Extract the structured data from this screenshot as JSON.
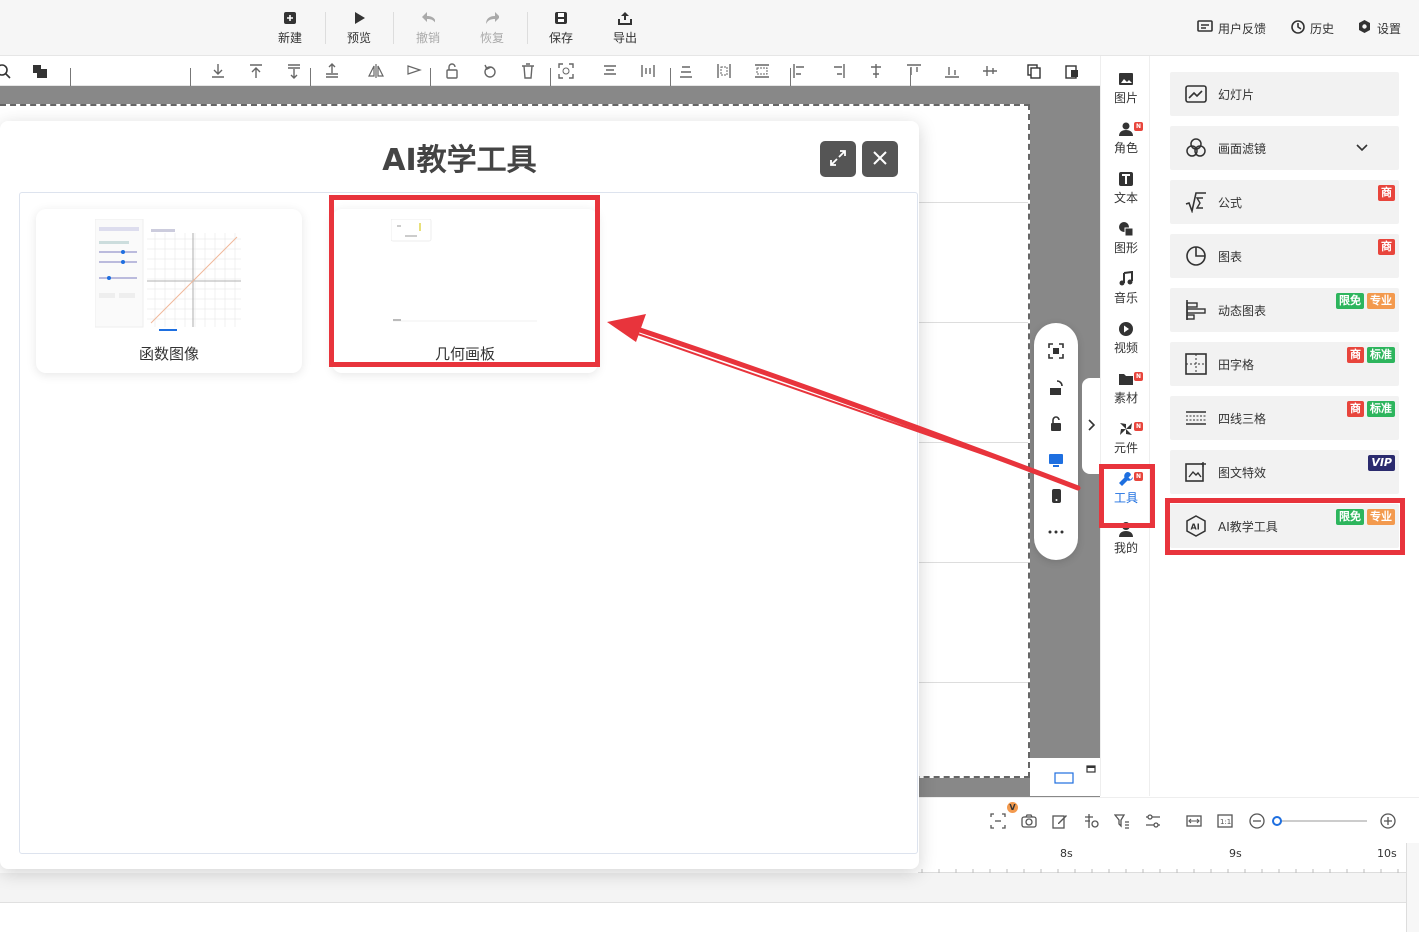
{
  "topbar": {
    "new_label": "新建",
    "preview_label": "预览",
    "undo_label": "撤销",
    "redo_label": "恢复",
    "save_label": "保存",
    "export_label": "导出",
    "feedback_label": "用户反馈",
    "history_label": "历史",
    "settings_label": "设置"
  },
  "nav": {
    "items": [
      {
        "label": "图片",
        "icon": "image-icon",
        "badge": ""
      },
      {
        "label": "角色",
        "icon": "person-icon",
        "badge": "N"
      },
      {
        "label": "文本",
        "icon": "text-icon",
        "badge": ""
      },
      {
        "label": "图形",
        "icon": "shape-icon",
        "badge": ""
      },
      {
        "label": "音乐",
        "icon": "music-icon",
        "badge": ""
      },
      {
        "label": "视频",
        "icon": "video-icon",
        "badge": ""
      },
      {
        "label": "素材",
        "icon": "folder-icon",
        "badge": "N"
      },
      {
        "label": "元件",
        "icon": "pinwheel-icon",
        "badge": "N"
      },
      {
        "label": "工具",
        "icon": "wrench-icon",
        "badge": "N"
      },
      {
        "label": "我的",
        "icon": "user-icon",
        "badge": ""
      }
    ]
  },
  "right_panel": {
    "items": [
      {
        "label": "幻灯片",
        "icon": "slideshow-icon",
        "badges": []
      },
      {
        "label": "画面滤镜",
        "icon": "filter-icon",
        "badges": []
      },
      {
        "label": "公式",
        "icon": "formula-icon",
        "badges": [
          "商"
        ]
      },
      {
        "label": "图表",
        "icon": "pie-chart-icon",
        "badges": [
          "商"
        ]
      },
      {
        "label": "动态图表",
        "icon": "bar-chart-icon",
        "badges": [
          "限免",
          "专业"
        ]
      },
      {
        "label": "田字格",
        "icon": "tian-grid-icon",
        "badges": [
          "商",
          "标准"
        ]
      },
      {
        "label": "四线三格",
        "icon": "four-line-icon",
        "badges": [
          "商",
          "标准"
        ]
      },
      {
        "label": "图文特效",
        "icon": "image-effect-icon",
        "badges": [
          "VIP"
        ]
      },
      {
        "label": "AI教学工具",
        "icon": "ai-icon",
        "badges": [
          "限免",
          "专业"
        ]
      }
    ]
  },
  "modal": {
    "title": "AI教学工具",
    "cards": [
      {
        "label": "函数图像"
      },
      {
        "label": "几何画板"
      }
    ]
  },
  "timeline": {
    "ticks": [
      "8s",
      "9s",
      "10s"
    ]
  },
  "bottom": {
    "v_badge": "V"
  },
  "colors": {
    "accent": "#1e6fe0",
    "highlight": "#e8343c",
    "badge_red": "#e8453c",
    "badge_green": "#2db55d",
    "badge_orange": "#f39a4e"
  }
}
